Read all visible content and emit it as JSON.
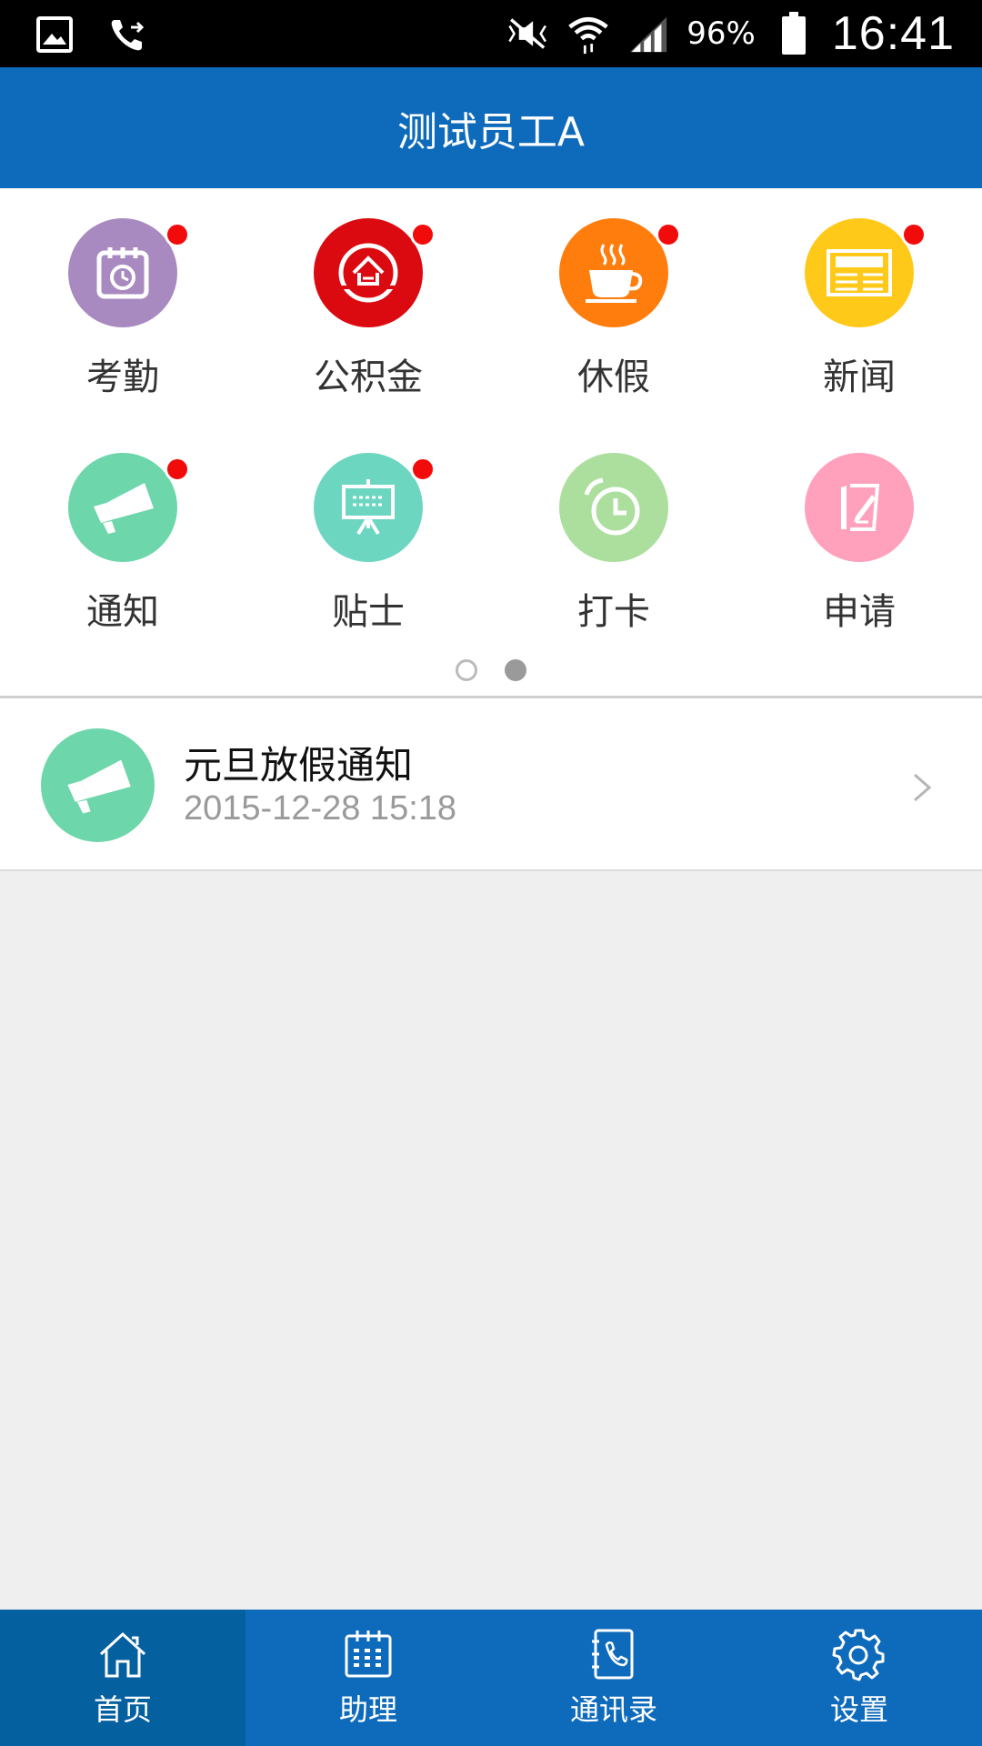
{
  "status_bar": {
    "battery_percent": "96%",
    "time": "16:41",
    "icons": [
      "gallery-icon",
      "call-forward-icon",
      "mute-icon",
      "wifi-icon",
      "signal-icon",
      "battery-icon"
    ]
  },
  "header": {
    "title": "测试员工A"
  },
  "grid": {
    "items": [
      {
        "label": "考勤",
        "color": "#a88ac0",
        "icon": "attendance-calendar-icon",
        "badge": true
      },
      {
        "label": "公积金",
        "color": "#db0a10",
        "icon": "housing-fund-icon",
        "badge": true
      },
      {
        "label": "休假",
        "color": "#ff7d0d",
        "icon": "coffee-cup-icon",
        "badge": true
      },
      {
        "label": "新闻",
        "color": "#ffc91a",
        "icon": "newspaper-icon",
        "badge": true
      },
      {
        "label": "通知",
        "color": "#6dd6ab",
        "icon": "megaphone-icon",
        "badge": true
      },
      {
        "label": "贴士",
        "color": "#6dd6c1",
        "icon": "presentation-board-icon",
        "badge": true
      },
      {
        "label": "打卡",
        "color": "#acde9e",
        "icon": "alarm-clock-icon",
        "badge": false
      },
      {
        "label": "申请",
        "color": "#ffa0bd",
        "icon": "edit-form-icon",
        "badge": false
      }
    ],
    "page_count": 2,
    "current_page": 1
  },
  "notices": [
    {
      "title": "元旦放假通知",
      "time": "2015-12-28 15:18",
      "icon": "megaphone-icon"
    }
  ],
  "bottom_nav": {
    "items": [
      {
        "label": "首页",
        "icon": "home-icon",
        "active": true
      },
      {
        "label": "助理",
        "icon": "calendar-grid-icon",
        "active": false
      },
      {
        "label": "通讯录",
        "icon": "address-book-icon",
        "active": false
      },
      {
        "label": "设置",
        "icon": "gear-icon",
        "active": false
      }
    ]
  },
  "colors": {
    "primary": "#0e6bbb",
    "nav_active": "#05609f",
    "badge": "#f20b0b",
    "background": "#efefef"
  }
}
